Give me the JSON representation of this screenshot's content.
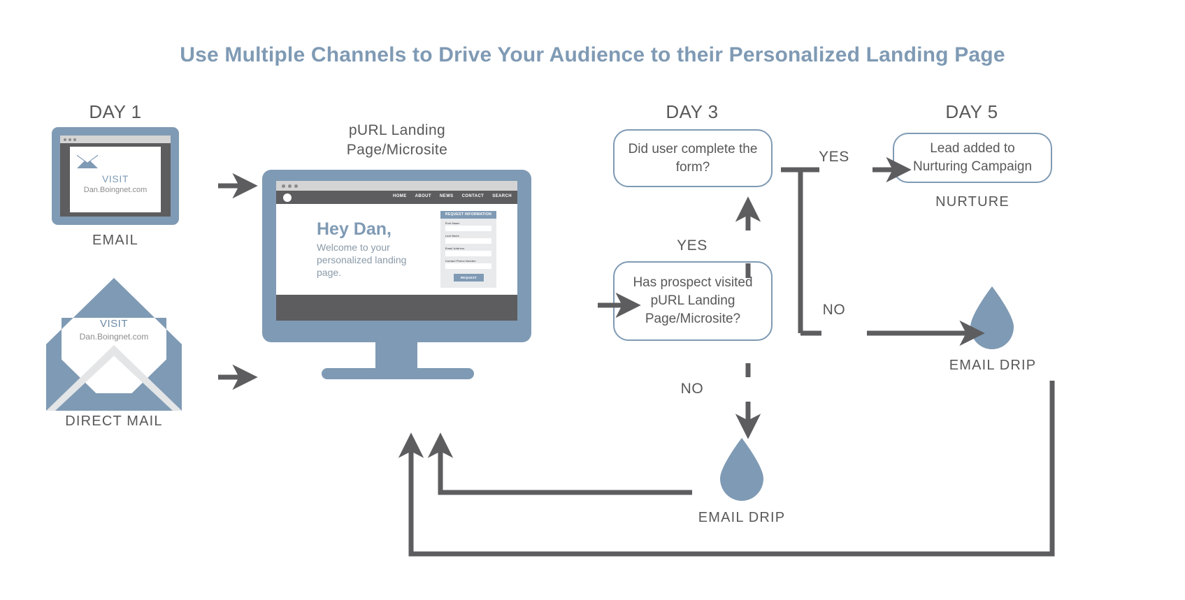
{
  "title": "Use Multiple Channels to Drive Your Audience to their Personalized Landing Page",
  "colors": {
    "brand_blue": "#7f9ab4",
    "text_gray": "#58585a",
    "arrow_gray": "#5d5d5f",
    "light_gray": "#d4d4d4"
  },
  "columns": {
    "day1": "DAY 1",
    "day3": "DAY 3",
    "day5": "DAY 5"
  },
  "email_channel": {
    "caption": "EMAIL",
    "visit": "VISIT",
    "url": "Dan.Boingnet.com",
    "icon": "envelope-icon"
  },
  "direct_mail_channel": {
    "caption": "DIRECT MAIL",
    "visit": "VISIT",
    "url": "Dan.Boingnet.com"
  },
  "landing_page": {
    "heading_line1": "pURL Landing",
    "heading_line2": "Page/Microsite",
    "nav": [
      "HOME",
      "ABOUT",
      "NEWS",
      "CONTACT",
      "SEARCH"
    ],
    "headline": "Hey Dan,",
    "subtext": "Welcome to your personalized landing page.",
    "form": {
      "header": "REQUEST INFORMATION",
      "fields": [
        "First Name",
        "Last Name",
        "Email Address",
        "Contact Phone Number"
      ],
      "submit": "REQUEST"
    }
  },
  "decisions": {
    "did_complete_form": "Did user complete the form?",
    "has_visited": "Has prospect visited pURL Landing Page/Microsite?",
    "lead_added": "Lead added to Nurturing Campaign"
  },
  "flow": {
    "yes_up": "YES",
    "yes_right": "YES",
    "no_right": "NO",
    "no_down": "NO",
    "nurture": "NURTURE",
    "email_drip_bottom": "EMAIL DRIP",
    "email_drip_right": "EMAIL DRIP"
  }
}
